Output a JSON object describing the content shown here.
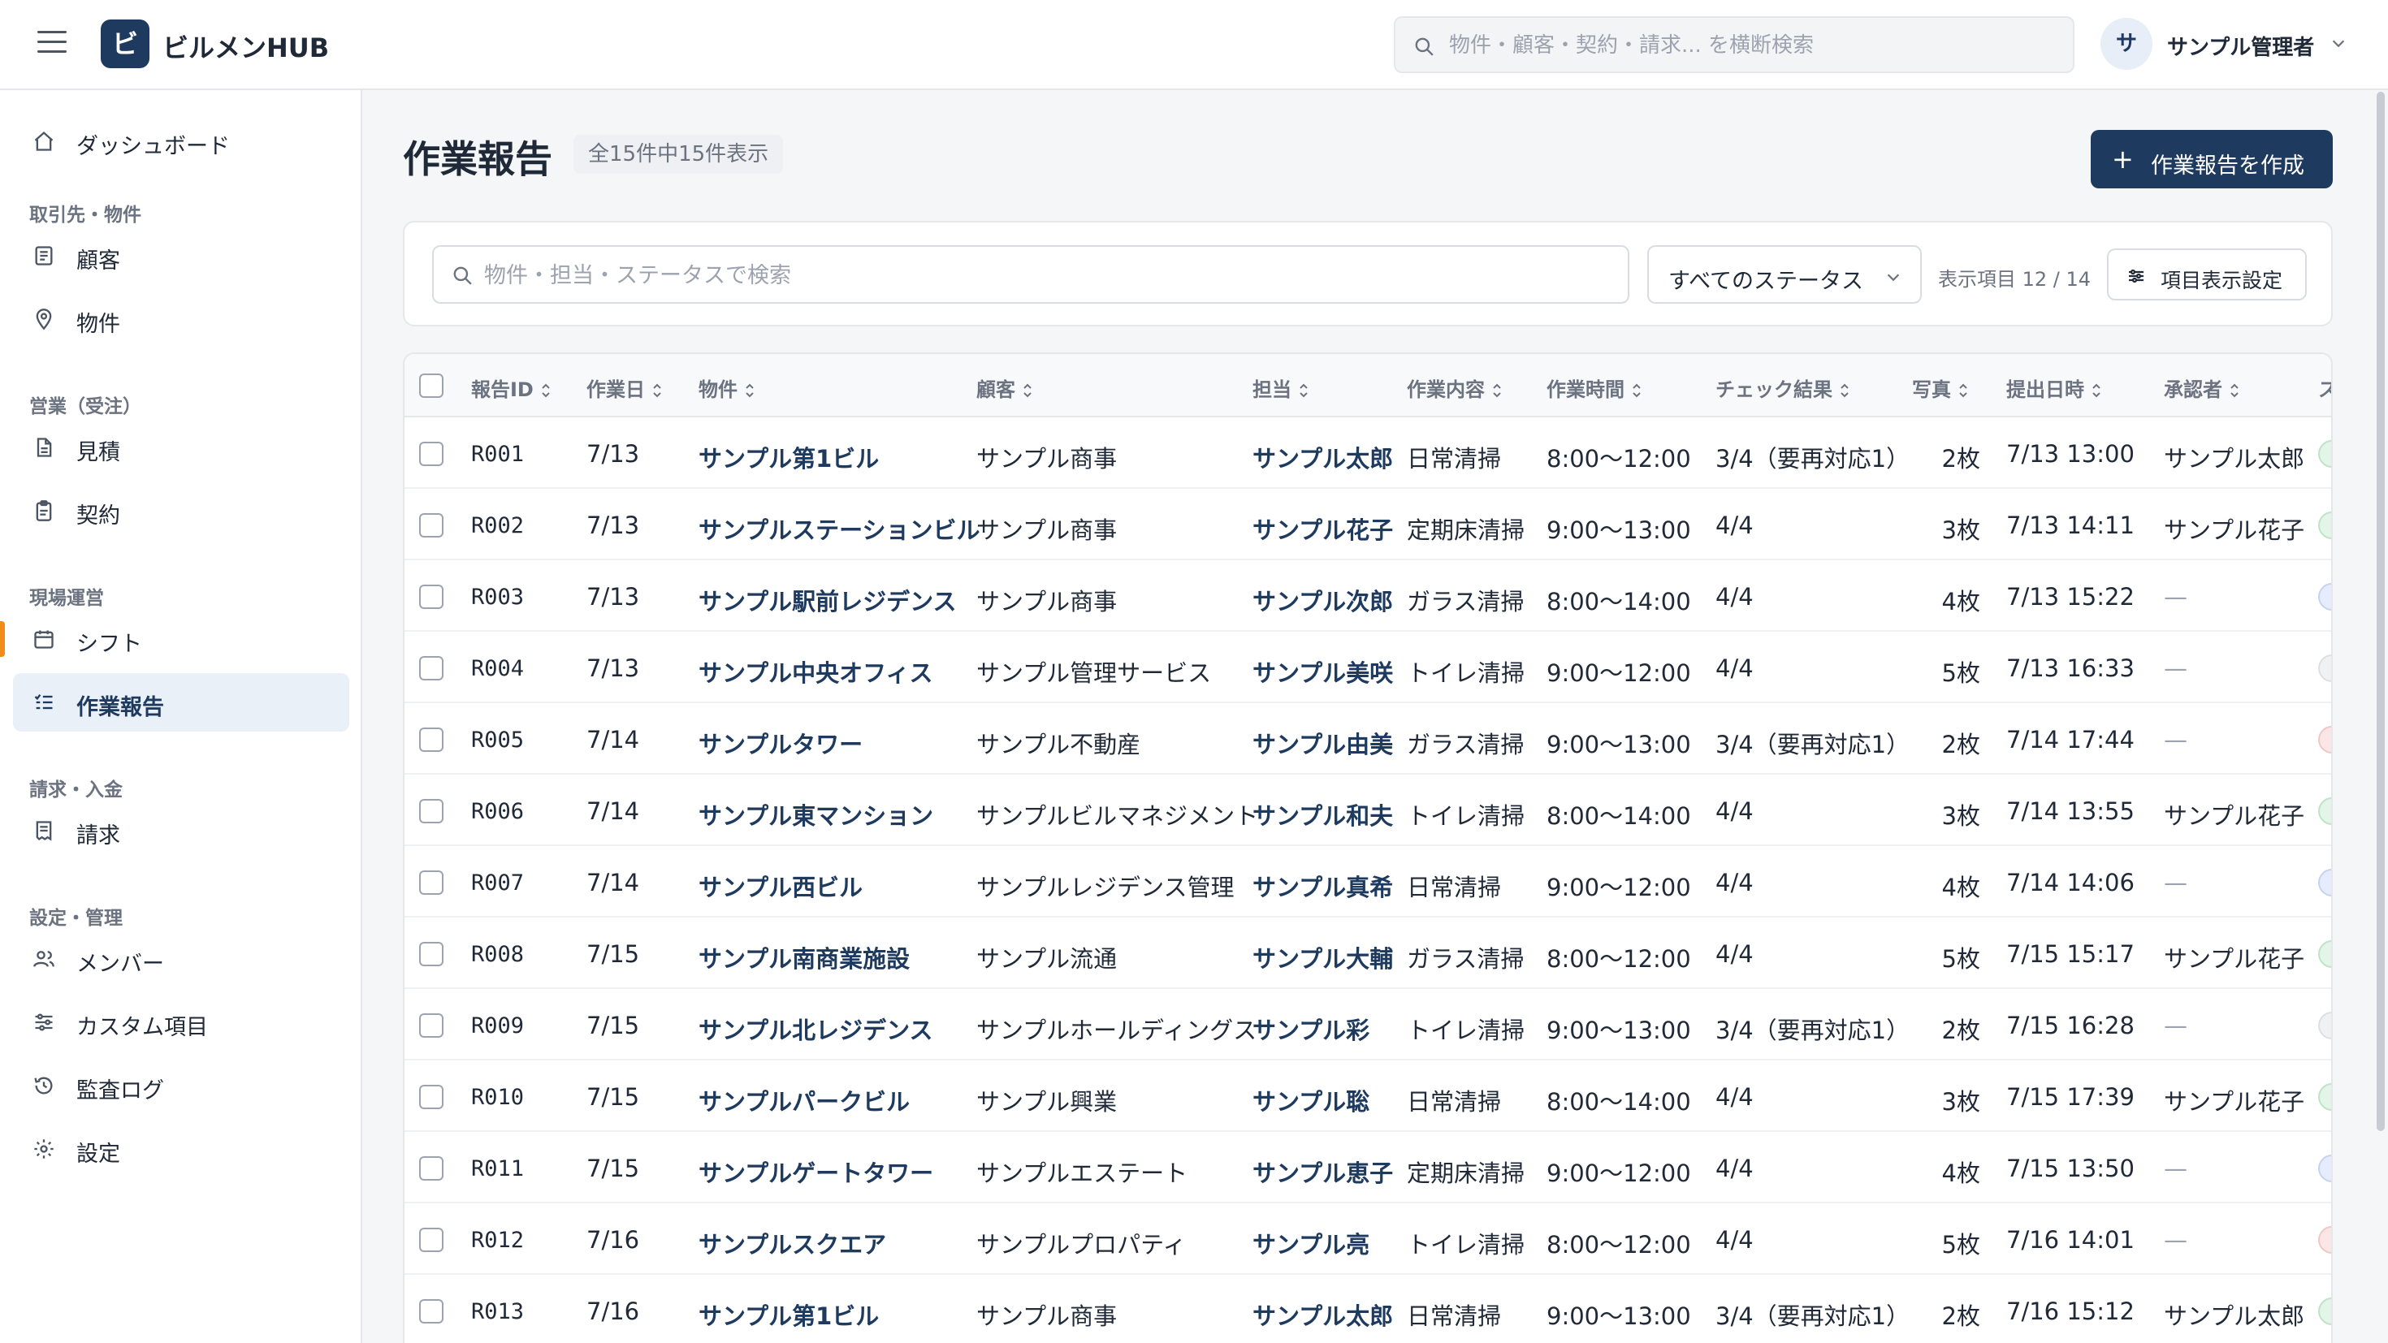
{
  "app": {
    "logo_char": "ビ",
    "name": "ビルメンHUB"
  },
  "header": {
    "search_placeholder": "物件・顧客・契約・請求... を横断検索",
    "user_initial": "サ",
    "user_name": "サンプル管理者"
  },
  "sidebar": {
    "dashboard": "ダッシュボード",
    "sections": {
      "clients": "取引先・物件",
      "sales": "営業（受注）",
      "field": "現場運営",
      "billing": "請求・入金",
      "admin": "設定・管理"
    },
    "items": {
      "customers": "顧客",
      "properties": "物件",
      "estimates": "見積",
      "contracts": "契約",
      "shifts": "シフト",
      "reports": "作業報告",
      "invoices": "請求",
      "members": "メンバー",
      "custom_fields": "カスタム項目",
      "audit_log": "監査ログ",
      "settings": "設定"
    },
    "active": "reports"
  },
  "page": {
    "title": "作業報告",
    "count_text": "全15件中15件表示",
    "create_button": "作業報告を作成"
  },
  "filters": {
    "search_placeholder": "物件・担当・ステータスで検索",
    "status_value": "すべてのステータス",
    "column_count": "表示項目 12 / 14",
    "column_settings": "項目表示設定"
  },
  "table": {
    "columns": [
      "報告ID",
      "作業日",
      "物件",
      "顧客",
      "担当",
      "作業内容",
      "作業時間",
      "チェック結果",
      "写真",
      "提出日時",
      "承認者",
      "ス"
    ],
    "rows": [
      {
        "id": "R001",
        "date": "7/13",
        "property": "サンプル第1ビル",
        "customer": "サンプル商事",
        "staff": "サンプル太郎",
        "task": "日常清掃",
        "time": "8:00〜12:00",
        "check": "3/4（要再対応1）",
        "photos": "2枚",
        "submitted": "7/13 13:00",
        "approver": "サンプル太郎",
        "status_color": "#e3f4e8",
        "status_border": "#bfe3c9"
      },
      {
        "id": "R002",
        "date": "7/13",
        "property": "サンプルステーションビル",
        "customer": "サンプル商事",
        "staff": "サンプル花子",
        "task": "定期床清掃",
        "time": "9:00〜13:00",
        "check": "4/4",
        "photos": "3枚",
        "submitted": "7/13 14:11",
        "approver": "サンプル花子",
        "status_color": "#e3f4e8",
        "status_border": "#bfe3c9"
      },
      {
        "id": "R003",
        "date": "7/13",
        "property": "サンプル駅前レジデンス",
        "customer": "サンプル商事",
        "staff": "サンプル次郎",
        "task": "ガラス清掃",
        "time": "8:00〜14:00",
        "check": "4/4",
        "photos": "4枚",
        "submitted": "7/13 15:22",
        "approver": "—",
        "status_color": "#e6ecfb",
        "status_border": "#c5d3f3"
      },
      {
        "id": "R004",
        "date": "7/13",
        "property": "サンプル中央オフィス",
        "customer": "サンプル管理サービス",
        "staff": "サンプル美咲",
        "task": "トイレ清掃",
        "time": "9:00〜12:00",
        "check": "4/4",
        "photos": "5枚",
        "submitted": "7/13 16:33",
        "approver": "—",
        "status_color": "#f0f1f3",
        "status_border": "#dcdfe4"
      },
      {
        "id": "R005",
        "date": "7/14",
        "property": "サンプルタワー",
        "customer": "サンプル不動産",
        "staff": "サンプル由美",
        "task": "ガラス清掃",
        "time": "9:00〜13:00",
        "check": "3/4（要再対応1）",
        "photos": "2枚",
        "submitted": "7/14 17:44",
        "approver": "—",
        "status_color": "#fbe6e6",
        "status_border": "#f2c6c6"
      },
      {
        "id": "R006",
        "date": "7/14",
        "property": "サンプル東マンション",
        "customer": "サンプルビルマネジメント",
        "staff": "サンプル和夫",
        "task": "トイレ清掃",
        "time": "8:00〜14:00",
        "check": "4/4",
        "photos": "3枚",
        "submitted": "7/14 13:55",
        "approver": "サンプル花子",
        "status_color": "#e3f4e8",
        "status_border": "#bfe3c9"
      },
      {
        "id": "R007",
        "date": "7/14",
        "property": "サンプル西ビル",
        "customer": "サンプルレジデンス管理",
        "staff": "サンプル真希",
        "task": "日常清掃",
        "time": "9:00〜12:00",
        "check": "4/4",
        "photos": "4枚",
        "submitted": "7/14 14:06",
        "approver": "—",
        "status_color": "#e6ecfb",
        "status_border": "#c5d3f3"
      },
      {
        "id": "R008",
        "date": "7/15",
        "property": "サンプル南商業施設",
        "customer": "サンプル流通",
        "staff": "サンプル大輔",
        "task": "ガラス清掃",
        "time": "8:00〜12:00",
        "check": "4/4",
        "photos": "5枚",
        "submitted": "7/15 15:17",
        "approver": "サンプル花子",
        "status_color": "#e3f4e8",
        "status_border": "#bfe3c9"
      },
      {
        "id": "R009",
        "date": "7/15",
        "property": "サンプル北レジデンス",
        "customer": "サンプルホールディングス",
        "staff": "サンプル彩",
        "task": "トイレ清掃",
        "time": "9:00〜13:00",
        "check": "3/4（要再対応1）",
        "photos": "2枚",
        "submitted": "7/15 16:28",
        "approver": "—",
        "status_color": "#f0f1f3",
        "status_border": "#dcdfe4"
      },
      {
        "id": "R010",
        "date": "7/15",
        "property": "サンプルパークビル",
        "customer": "サンプル興業",
        "staff": "サンプル聡",
        "task": "日常清掃",
        "time": "8:00〜14:00",
        "check": "4/4",
        "photos": "3枚",
        "submitted": "7/15 17:39",
        "approver": "サンプル花子",
        "status_color": "#e3f4e8",
        "status_border": "#bfe3c9"
      },
      {
        "id": "R011",
        "date": "7/15",
        "property": "サンプルゲートタワー",
        "customer": "サンプルエステート",
        "staff": "サンプル恵子",
        "task": "定期床清掃",
        "time": "9:00〜12:00",
        "check": "4/4",
        "photos": "4枚",
        "submitted": "7/15 13:50",
        "approver": "—",
        "status_color": "#e6ecfb",
        "status_border": "#c5d3f3"
      },
      {
        "id": "R012",
        "date": "7/16",
        "property": "サンプルスクエア",
        "customer": "サンプルプロパティ",
        "staff": "サンプル亮",
        "task": "トイレ清掃",
        "time": "8:00〜12:00",
        "check": "4/4",
        "photos": "5枚",
        "submitted": "7/16 14:01",
        "approver": "—",
        "status_color": "#fbe6e6",
        "status_border": "#f2c6c6"
      },
      {
        "id": "R013",
        "date": "7/16",
        "property": "サンプル第1ビル",
        "customer": "サンプル商事",
        "staff": "サンプル太郎",
        "task": "日常清掃",
        "time": "9:00〜13:00",
        "check": "3/4（要再対応1）",
        "photos": "2枚",
        "submitted": "7/16 15:12",
        "approver": "サンプル太郎",
        "status_color": "#e3f4e8",
        "status_border": "#bfe3c9"
      }
    ]
  }
}
